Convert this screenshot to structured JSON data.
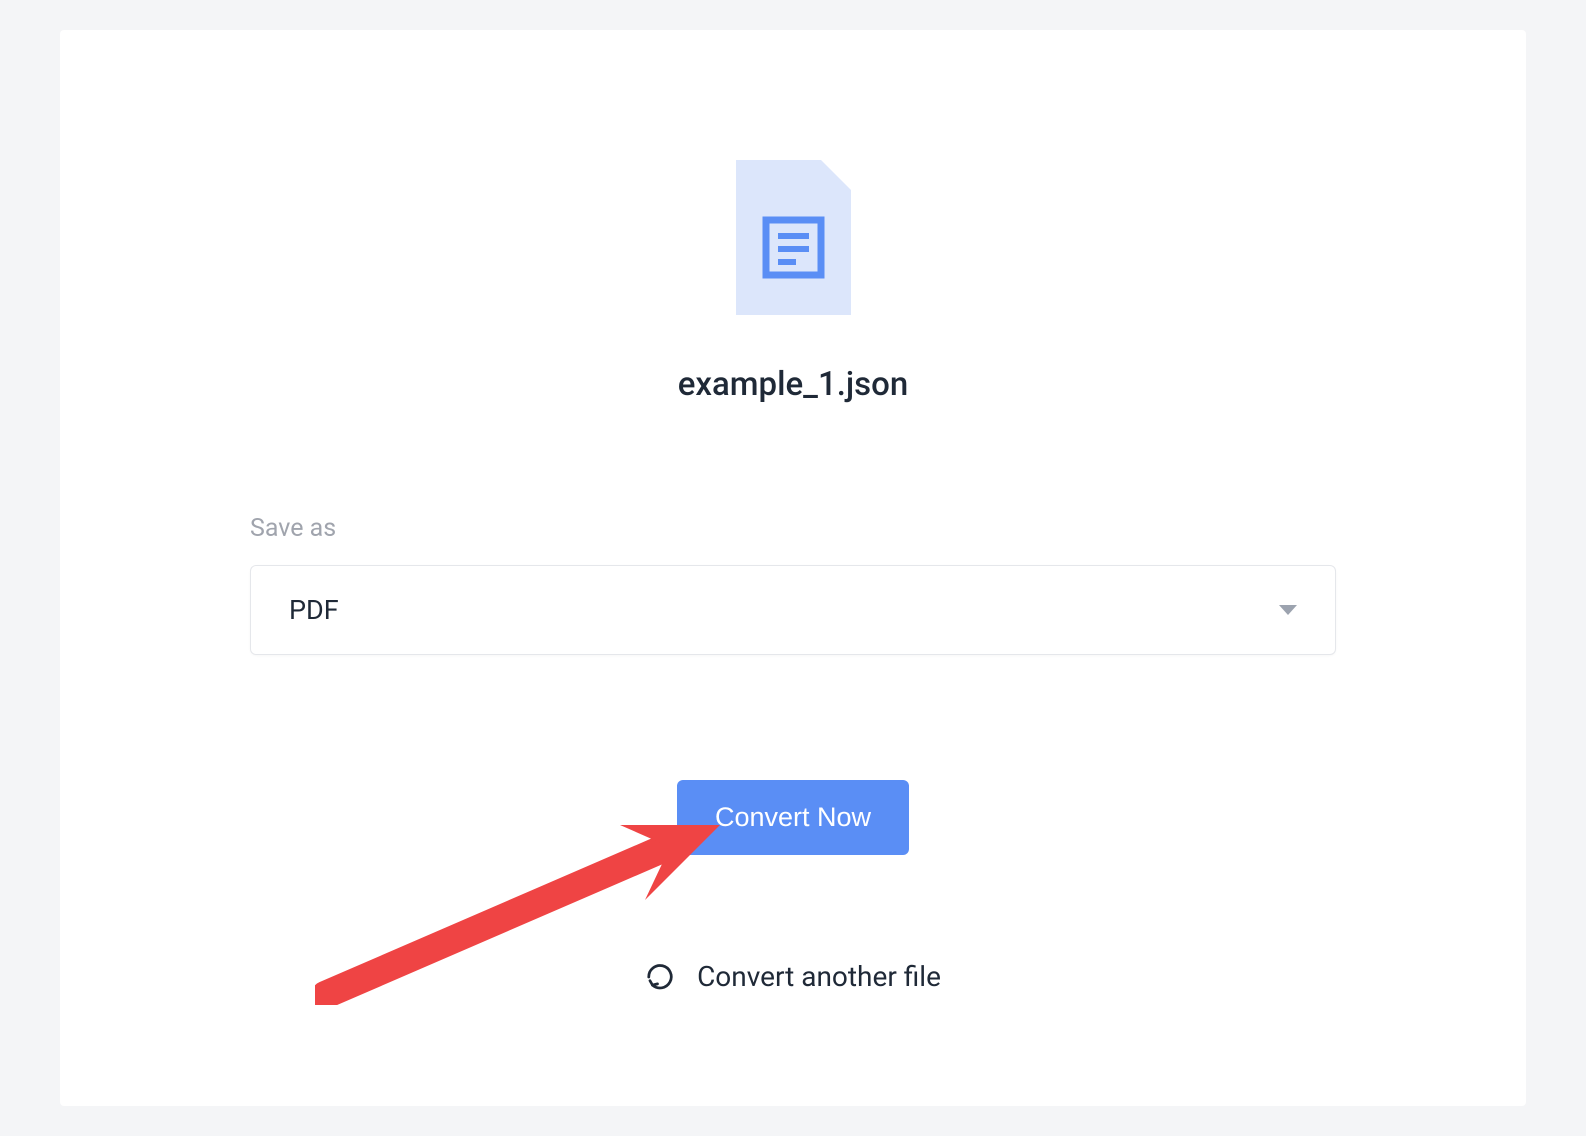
{
  "file": {
    "name": "example_1.json"
  },
  "form": {
    "save_as_label": "Save as",
    "selected_format": "PDF"
  },
  "actions": {
    "convert_now": "Convert Now",
    "convert_another": "Convert another file"
  }
}
